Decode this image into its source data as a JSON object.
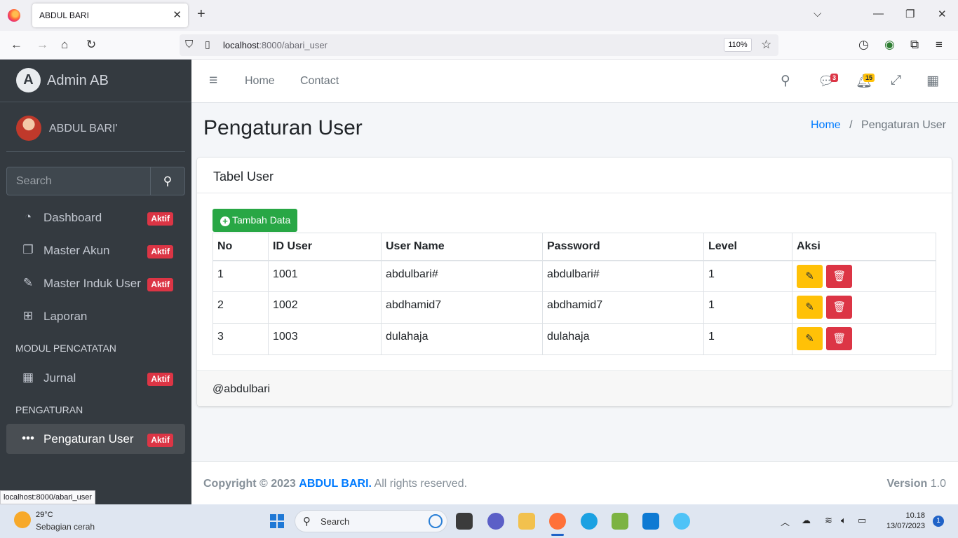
{
  "browser": {
    "tab_title": "ABDUL BARI",
    "url_host": "localhost",
    "url_rest": ":8000/abari_user",
    "zoom": "110%",
    "status_url": "localhost:8000/abari_user"
  },
  "sidebar": {
    "brand": "Admin AB",
    "brand_logo": "A",
    "user": "ABDUL BARI'",
    "search_placeholder": "Search",
    "items": [
      {
        "label": "Dashboard",
        "icon": "tachometer-icon",
        "badge": "Aktif"
      },
      {
        "label": "Master Akun",
        "icon": "copy-icon",
        "badge": "Aktif"
      },
      {
        "label": "Master Induk User",
        "icon": "edit-icon",
        "badge": "Aktif"
      },
      {
        "label": "Laporan",
        "icon": "table-icon",
        "badge": ""
      }
    ],
    "header_modul": "MODUL PENCATATAN",
    "jurnal": {
      "label": "Jurnal",
      "icon": "calendar-icon",
      "badge": "Aktif"
    },
    "header_pengaturan": "PENGATURAN",
    "pengaturan": {
      "label": "Pengaturan User",
      "icon": "ellipsis-icon",
      "badge": "Aktif"
    }
  },
  "topnav": {
    "home": "Home",
    "contact": "Contact",
    "messages_count": "3",
    "notifications_count": "15"
  },
  "page": {
    "title": "Pengaturan User",
    "breadcrumb_home": "Home",
    "breadcrumb_sep": "/",
    "breadcrumb_current": "Pengaturan User"
  },
  "card": {
    "title": "Tabel User",
    "add_button": "Tambah Data",
    "columns": [
      "No",
      "ID User",
      "User Name",
      "Password",
      "Level",
      "Aksi"
    ],
    "rows": [
      [
        "1",
        "1001",
        "abdulbari#",
        "abdulbari#",
        "1"
      ],
      [
        "2",
        "1002",
        "abdhamid7",
        "abdhamid7",
        "1"
      ],
      [
        "3",
        "1003",
        "dulahaja",
        "dulahaja",
        "1"
      ]
    ],
    "footer": "@abdulbari"
  },
  "footer": {
    "copyright": "Copyright © 2023",
    "brand": "ABDUL BARI.",
    "rights": "All rights reserved.",
    "version_label": "Version",
    "version": "1.0"
  },
  "taskbar": {
    "temp": "29°C",
    "weather": "Sebagian cerah",
    "search": "Search",
    "time": "10.18",
    "date": "13/07/2023",
    "notifications": "1"
  }
}
